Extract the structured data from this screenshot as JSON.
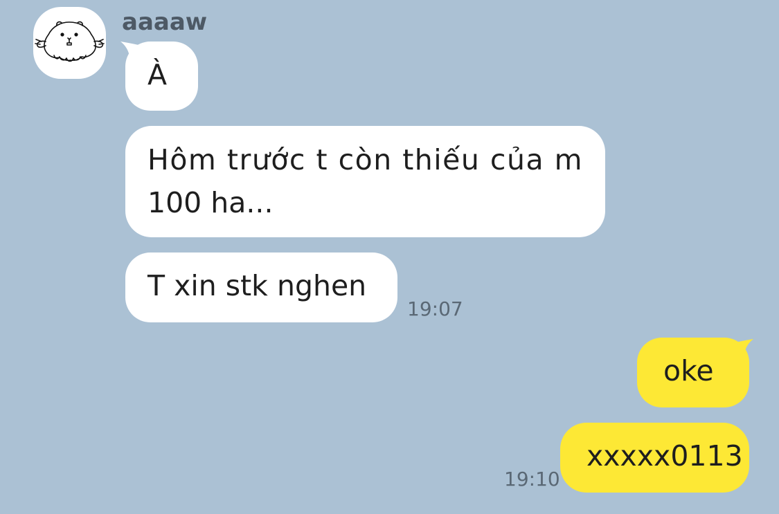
{
  "conversation": {
    "contact_name": "aaaaw",
    "avatar_icon": "hamster-icon",
    "colors": {
      "background": "#abc1d4",
      "incoming_bubble": "#ffffff",
      "outgoing_bubble": "#fde835"
    },
    "messages": [
      {
        "direction": "incoming",
        "text": "À"
      },
      {
        "direction": "incoming",
        "text_line1": "Hôm trước t còn thiếu của m",
        "text_line2": "100 ha..."
      },
      {
        "direction": "incoming",
        "text": "T xin stk nghen",
        "time": "19:07"
      },
      {
        "direction": "outgoing",
        "text": "oke"
      },
      {
        "direction": "outgoing",
        "text": "xxxxx0113",
        "time": "19:10"
      }
    ]
  }
}
